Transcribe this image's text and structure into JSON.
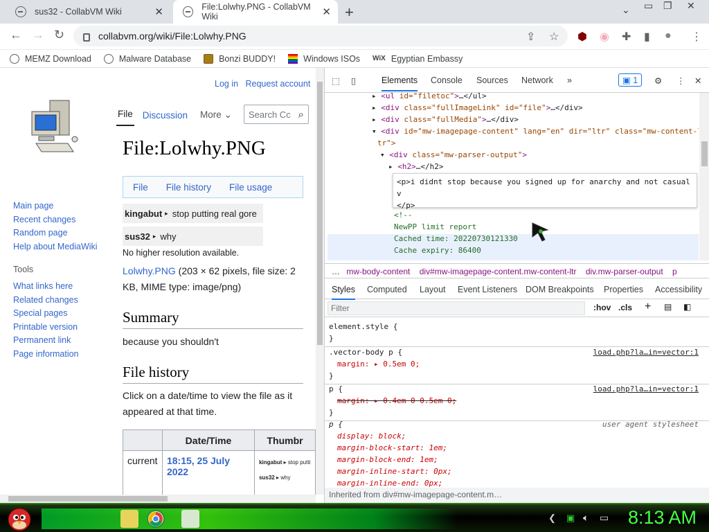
{
  "browser": {
    "tabs": [
      {
        "title": "sus32 - CollabVM Wiki",
        "active": false
      },
      {
        "title": "File:Lolwhy.PNG - CollabVM Wiki",
        "active": true
      }
    ],
    "url": "collabvm.org/wiki/File:Lolwhy.PNG",
    "bookmarks": [
      "MEMZ Download",
      "Malware Database",
      "Bonzi BUDDY!",
      "Windows ISOs",
      "Egyptian Embassy"
    ]
  },
  "wiki": {
    "top_links": [
      "Log in",
      "Request account"
    ],
    "page_tabs": [
      "File",
      "Discussion",
      "More"
    ],
    "search_placeholder": "Search Cc",
    "title": "File:Lolwhy.PNG",
    "file_toc": [
      "File",
      "File history",
      "File usage"
    ],
    "preview_rows": [
      {
        "user": "kingabut",
        "text": "stop putting real gore"
      },
      {
        "user": "sus32",
        "text": "why"
      }
    ],
    "no_higher": "No higher resolution available.",
    "file_link": "Lolwhy.PNG",
    "file_info": " (203 × 62 pixels, file size: 2 KB, MIME type: image/png)",
    "summary_heading": "Summary",
    "summary_text": "because you shouldn't",
    "history_heading": "File history",
    "history_text": "Click on a date/time to view the file as it appeared at that time.",
    "history_table": {
      "headers": [
        "",
        "Date/Time",
        "Thumbr"
      ],
      "row": {
        "label": "current",
        "date": "18:15, 25 July 2022",
        "thumb_user1": "kingabut",
        "thumb_text1": "stop putti",
        "thumb_user2": "sus32",
        "thumb_text2": "why"
      }
    },
    "nav_links": [
      "Main page",
      "Recent changes",
      "Random page",
      "Help about MediaWiki"
    ],
    "tools_heading": "Tools",
    "tools_links": [
      "What links here",
      "Related changes",
      "Special pages",
      "Printable version",
      "Permanent link",
      "Page information"
    ]
  },
  "devtools": {
    "tabs": [
      "Elements",
      "Console",
      "Sources",
      "Network"
    ],
    "issues_count": "1",
    "dom_lines": [
      {
        "tag": "ul",
        "attrs": "id=\"filetoc\"",
        "tail": "…</ul>"
      },
      {
        "tag": "div",
        "attrs": "class=\"fullImageLink\" id=\"file\"",
        "tail": "…</div>"
      },
      {
        "tag": "div",
        "attrs": "class=\"fullMedia\"",
        "tail": "…</div>"
      },
      {
        "tag": "div",
        "attrs": "id=\"mw-imagepage-content\" lang=\"en\" dir=\"ltr\" class=\"mw-content-l",
        "tail": ""
      },
      {
        "tag": "div",
        "attrs": "class=\"mw-parser-output\"",
        "tail": ""
      },
      {
        "tag": "h2",
        "attrs": "",
        "tail": "…</h2>"
      }
    ],
    "dom_wrap": "tr\">",
    "editing": {
      "line1": "<p>i didnt stop because you signed up for anarchy and not casual",
      "line2": "v",
      "close": "</p>"
    },
    "comment_lines": [
      "<!--",
      "NewPP limit report",
      "Cached time: 20220730121330",
      "Cache expiry: 86400"
    ],
    "breadcrumbs": [
      "…",
      "mw-body-content",
      "div#mw-imagepage-content.mw-content-ltr",
      "div.mw-parser-output",
      "p"
    ],
    "style_tabs": [
      "Styles",
      "Computed",
      "Layout",
      "Event Listeners",
      "DOM Breakpoints",
      "Properties",
      "Accessibility"
    ],
    "filter_placeholder": "Filter",
    "filter_buttons": [
      ":hov",
      ".cls",
      "+"
    ],
    "rules": [
      {
        "selector": "element.style {",
        "source": "",
        "decls": [],
        "close": "}"
      },
      {
        "selector": ".vector-body p {",
        "source": "load.php?la…in=vector:1",
        "decls": [
          "margin: ▸ 0.5em 0;"
        ],
        "close": "}"
      },
      {
        "selector": "p {",
        "source": "load.php?la…in=vector:1",
        "decls": [
          "margin: ▸ 0.4em 0 0.5em 0;"
        ],
        "close": "}"
      },
      {
        "selector": "p {",
        "source": "user agent stylesheet",
        "decls": [
          "display: block;",
          "margin-block-start: 1em;",
          "margin-block-end: 1em;",
          "margin-inline-start: 0px;",
          "margin-inline-end: 0px;"
        ],
        "close": "}"
      }
    ],
    "inherited": "Inherited from div#mw-imagepage-content.m…"
  },
  "taskbar": {
    "clock": "8:13 AM"
  }
}
